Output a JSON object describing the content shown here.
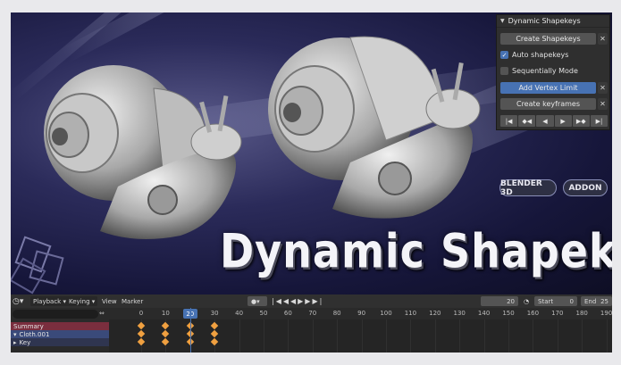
{
  "panel": {
    "title": "Dynamic Shapekeys",
    "create_shapekeys": "Create Shapekeys",
    "auto_shapekeys": "Auto shapekeys",
    "sequentially_mode": "Sequentially Mode",
    "add_vertex_limit": "Add Vertex Limit",
    "create_keyframes": "Create keyframes",
    "close_glyph": "✕"
  },
  "viewport": {
    "title": "Dynamic  Shapekeys",
    "pill_blender": "BLENDER 3D",
    "pill_addon": "ADDON"
  },
  "timeline": {
    "playback": "Playback",
    "keying": "Keying",
    "view": "View",
    "marker": "Marker",
    "current_frame": "20",
    "start_label": "Start",
    "start_value": "0",
    "end_label": "End",
    "end_value": "25",
    "frames": [
      "0",
      "10",
      "20",
      "30",
      "40",
      "50",
      "60",
      "70",
      "80",
      "90",
      "100",
      "110",
      "120",
      "130",
      "140",
      "150",
      "160",
      "170",
      "180",
      "190"
    ],
    "channels": [
      "Summary",
      "Cloth.001",
      "Key"
    ]
  },
  "colors": {
    "accent": "#4772b3",
    "keyframe": "#f0a040",
    "summary_row": "#7a2e3e",
    "object_row": "#3a4a7a"
  }
}
